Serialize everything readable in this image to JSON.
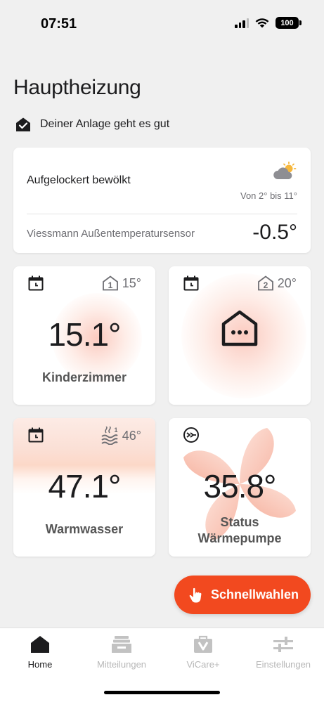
{
  "status_bar": {
    "time": "07:51",
    "battery": "100"
  },
  "header": {
    "title": "Hauptheizung",
    "status_text": "Deiner Anlage geht es gut"
  },
  "weather": {
    "condition": "Aufgelockert bewölkt",
    "range": "Von 2° bis 11°",
    "icon": "partly-cloudy-icon",
    "sensor_name": "Viessmann Außentemperatursensor",
    "sensor_value": "-0.5°"
  },
  "tiles": [
    {
      "name": "Kinderzimmer",
      "temperature": "15.1°",
      "setpoint": "15°",
      "circuit": "1",
      "icon": "calendar-icon"
    },
    {
      "name": "",
      "temperature": "",
      "setpoint": "20°",
      "circuit": "2",
      "icon": "calendar-icon"
    },
    {
      "name": "Warmwasser",
      "temperature": "47.1°",
      "setpoint": "46°",
      "circuit": "1",
      "icon": "calendar-icon"
    },
    {
      "name_line1": "Status",
      "name_line2": "Wärmepumpe",
      "temperature": "35.8°",
      "icon": "heat-pump-icon"
    }
  ],
  "fab": {
    "label": "Schnellwahlen"
  },
  "tabbar": {
    "items": [
      {
        "label": "Home",
        "active": true
      },
      {
        "label": "Mitteilungen",
        "active": false
      },
      {
        "label": "ViCare+",
        "active": false
      },
      {
        "label": "Einstellungen",
        "active": false
      }
    ]
  },
  "colors": {
    "accent": "#f2491f",
    "text": "#1c1c1e",
    "muted": "#6e6e73",
    "background": "#f0f0f0"
  }
}
